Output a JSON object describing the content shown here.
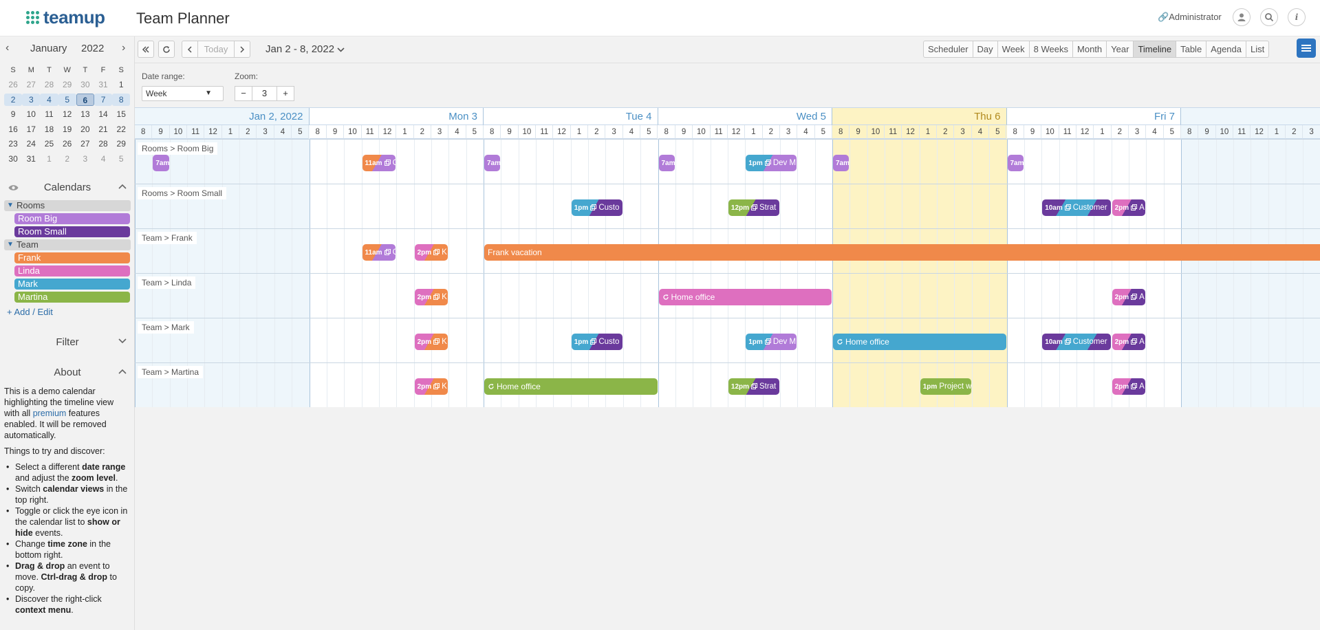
{
  "header": {
    "logo_text": "teamup",
    "title": "Team Planner",
    "admin_label": "Administrator"
  },
  "mini_calendar": {
    "month": "January",
    "year": "2022",
    "dow": [
      "S",
      "M",
      "T",
      "W",
      "T",
      "F",
      "S"
    ],
    "weeks": [
      [
        "26",
        "27",
        "28",
        "29",
        "30",
        "31",
        "1"
      ],
      [
        "2",
        "3",
        "4",
        "5",
        "6",
        "7",
        "8"
      ],
      [
        "9",
        "10",
        "11",
        "12",
        "13",
        "14",
        "15"
      ],
      [
        "16",
        "17",
        "18",
        "19",
        "20",
        "21",
        "22"
      ],
      [
        "23",
        "24",
        "25",
        "26",
        "27",
        "28",
        "29"
      ],
      [
        "30",
        "31",
        "1",
        "2",
        "3",
        "4",
        "5"
      ]
    ]
  },
  "sidebar": {
    "calendars_title": "Calendars",
    "groups": [
      {
        "name": "Rooms",
        "items": [
          {
            "name": "Room Big",
            "color": "#b17bd8"
          },
          {
            "name": "Room Small",
            "color": "#6a3a9c"
          }
        ]
      },
      {
        "name": "Team",
        "items": [
          {
            "name": "Frank",
            "color": "#f0894a"
          },
          {
            "name": "Linda",
            "color": "#de6fbf"
          },
          {
            "name": "Mark",
            "color": "#45a7cf"
          },
          {
            "name": "Martina",
            "color": "#8bb548"
          }
        ]
      }
    ],
    "add_edit": "+ Add / Edit",
    "filter_title": "Filter",
    "about_title": "About",
    "about": {
      "p1_a": "This is a demo calendar highlighting the timeline view with all ",
      "p1_link": "premium",
      "p1_b": " features enabled. It will be removed automatically.",
      "p2": "Things to try and discover:",
      "tips": [
        {
          "a": "Select a different ",
          "b": "date range",
          "c": " and adjust the ",
          "d": "zoom level",
          "e": "."
        },
        {
          "a": "Switch ",
          "b": "calendar views",
          "c": " in the top right.",
          "d": "",
          "e": ""
        },
        {
          "a": "Toggle or click the eye icon in the calendar list to ",
          "b": "show or hide",
          "c": " events.",
          "d": "",
          "e": ""
        },
        {
          "a": "Change ",
          "b": "time zone",
          "c": " in the bottom right.",
          "d": "",
          "e": ""
        },
        {
          "a": "",
          "b": "Drag & drop",
          "c": " an event to move. ",
          "d": "Ctrl-drag & drop",
          "e": " to copy."
        },
        {
          "a": "Discover the right-click ",
          "b": "context menu",
          "c": ".",
          "d": "",
          "e": ""
        }
      ]
    }
  },
  "toolbar": {
    "today_label": "Today",
    "date_range": "Jan 2 - 8, 2022",
    "views": [
      "Scheduler",
      "Day",
      "Week",
      "8 Weeks",
      "Month",
      "Year",
      "Timeline",
      "Table",
      "Agenda",
      "List"
    ],
    "active_view": "Timeline"
  },
  "options": {
    "date_range_label": "Date range:",
    "date_range_value": "Week",
    "zoom_label": "Zoom:",
    "zoom_value": "3",
    "zoom_minus": "−",
    "zoom_plus": "+"
  },
  "timeline": {
    "days": [
      {
        "label": "Jan 2, 2022",
        "today": false
      },
      {
        "label": "Mon 3",
        "today": false
      },
      {
        "label": "Tue 4",
        "today": false
      },
      {
        "label": "Wed 5",
        "today": false
      },
      {
        "label": "Thu 6",
        "today": true
      },
      {
        "label": "Fri 7",
        "today": false
      },
      {
        "label": "",
        "today": false
      }
    ],
    "hours": [
      "8",
      "9",
      "10",
      "11",
      "12",
      "1",
      "2",
      "3",
      "4",
      "5"
    ],
    "rows": [
      "Rooms > Room Big",
      "Rooms > Room Small",
      "Team > Frank",
      "Team > Linda",
      "Team > Mark",
      "Team > Martina"
    ],
    "events": [
      {
        "row": 0,
        "day": 0,
        "start": 9.0,
        "end": 10.0,
        "time": "7am",
        "title": "",
        "colors": [
          "#b17bd8"
        ],
        "icon": ""
      },
      {
        "row": 0,
        "day": 1,
        "start": 11.0,
        "end": 13.0,
        "time": "11am",
        "title": "C",
        "colors": [
          "#f0894a",
          "#b17bd8"
        ],
        "icon": "copy"
      },
      {
        "row": 0,
        "day": 2,
        "start": 8.0,
        "end": 9.0,
        "time": "7am",
        "title": "",
        "colors": [
          "#b17bd8"
        ],
        "icon": ""
      },
      {
        "row": 0,
        "day": 3,
        "start": 8.0,
        "end": 9.0,
        "time": "7am",
        "title": "",
        "colors": [
          "#b17bd8"
        ],
        "icon": ""
      },
      {
        "row": 0,
        "day": 3,
        "start": 13.0,
        "end": 16.0,
        "time": "1pm",
        "title": "Dev M",
        "colors": [
          "#45a7cf",
          "#b17bd8"
        ],
        "icon": "copy"
      },
      {
        "row": 0,
        "day": 4,
        "start": 8.0,
        "end": 9.0,
        "time": "7am",
        "title": "",
        "colors": [
          "#b17bd8"
        ],
        "icon": ""
      },
      {
        "row": 0,
        "day": 5,
        "start": 8.0,
        "end": 9.0,
        "time": "7am",
        "title": "",
        "colors": [
          "#b17bd8"
        ],
        "icon": ""
      },
      {
        "row": 1,
        "day": 2,
        "start": 13.0,
        "end": 16.0,
        "time": "1pm",
        "title": "Custo",
        "colors": [
          "#45a7cf",
          "#6a3a9c"
        ],
        "icon": "copy"
      },
      {
        "row": 1,
        "day": 3,
        "start": 12.0,
        "end": 15.0,
        "time": "12pm",
        "title": "Strat",
        "colors": [
          "#8bb548",
          "#6a3a9c"
        ],
        "icon": "copy"
      },
      {
        "row": 1,
        "day": 5,
        "start": 10.0,
        "end": 14.0,
        "time": "10am",
        "title": "Customer",
        "colors": [
          "#6a3a9c",
          "#45a7cf",
          "#6a3a9c"
        ],
        "icon": "copy"
      },
      {
        "row": 1,
        "day": 5,
        "start": 14.0,
        "end": 16.0,
        "time": "2pm",
        "title": "A",
        "colors": [
          "#de6fbf",
          "#6a3a9c"
        ],
        "icon": "copy"
      },
      {
        "row": 2,
        "day": 1,
        "start": 11.0,
        "end": 13.0,
        "time": "11am",
        "title": "C",
        "colors": [
          "#f0894a",
          "#b17bd8"
        ],
        "icon": "copy"
      },
      {
        "row": 2,
        "day": 1,
        "start": 14.0,
        "end": 16.0,
        "time": "2pm",
        "title": "K",
        "colors": [
          "#de6fbf",
          "#f0894a"
        ],
        "icon": "copy"
      },
      {
        "row": 2,
        "day": 2,
        "start": 8.0,
        "end": 99.0,
        "time": "",
        "title": "Frank vacation",
        "colors": [
          "#f0894a"
        ],
        "icon": "",
        "long": true
      },
      {
        "row": 3,
        "day": 1,
        "start": 14.0,
        "end": 16.0,
        "time": "2pm",
        "title": "K",
        "colors": [
          "#de6fbf",
          "#f0894a"
        ],
        "icon": "copy"
      },
      {
        "row": 3,
        "day": 3,
        "start": 8.0,
        "end": 18.0,
        "time": "",
        "title": "Home office",
        "colors": [
          "#de6fbf"
        ],
        "icon": "repeat",
        "long": true
      },
      {
        "row": 3,
        "day": 5,
        "start": 14.0,
        "end": 16.0,
        "time": "2pm",
        "title": "A",
        "colors": [
          "#de6fbf",
          "#6a3a9c"
        ],
        "icon": "copy"
      },
      {
        "row": 4,
        "day": 1,
        "start": 14.0,
        "end": 16.0,
        "time": "2pm",
        "title": "K",
        "colors": [
          "#de6fbf",
          "#f0894a"
        ],
        "icon": "copy"
      },
      {
        "row": 4,
        "day": 2,
        "start": 13.0,
        "end": 16.0,
        "time": "1pm",
        "title": "Custo",
        "colors": [
          "#45a7cf",
          "#6a3a9c"
        ],
        "icon": "copy"
      },
      {
        "row": 4,
        "day": 3,
        "start": 13.0,
        "end": 16.0,
        "time": "1pm",
        "title": "Dev M",
        "colors": [
          "#45a7cf",
          "#b17bd8"
        ],
        "icon": "copy"
      },
      {
        "row": 4,
        "day": 4,
        "start": 8.0,
        "end": 18.0,
        "time": "",
        "title": "Home office",
        "colors": [
          "#45a7cf"
        ],
        "icon": "repeat",
        "long": true
      },
      {
        "row": 4,
        "day": 5,
        "start": 10.0,
        "end": 14.0,
        "time": "10am",
        "title": "Customer",
        "colors": [
          "#6a3a9c",
          "#45a7cf",
          "#6a3a9c"
        ],
        "icon": "copy"
      },
      {
        "row": 4,
        "day": 5,
        "start": 14.0,
        "end": 16.0,
        "time": "2pm",
        "title": "A",
        "colors": [
          "#de6fbf",
          "#6a3a9c"
        ],
        "icon": "copy"
      },
      {
        "row": 5,
        "day": 1,
        "start": 14.0,
        "end": 16.0,
        "time": "2pm",
        "title": "K",
        "colors": [
          "#de6fbf",
          "#f0894a"
        ],
        "icon": "copy"
      },
      {
        "row": 5,
        "day": 2,
        "start": 8.0,
        "end": 18.0,
        "time": "",
        "title": "Home office",
        "colors": [
          "#8bb548"
        ],
        "icon": "repeat",
        "long": true
      },
      {
        "row": 5,
        "day": 3,
        "start": 12.0,
        "end": 15.0,
        "time": "12pm",
        "title": "Strat",
        "colors": [
          "#8bb548",
          "#6a3a9c"
        ],
        "icon": "copy"
      },
      {
        "row": 5,
        "day": 4,
        "start": 13.0,
        "end": 16.0,
        "time": "1pm",
        "title": "Project w",
        "colors": [
          "#8bb548"
        ],
        "icon": ""
      },
      {
        "row": 5,
        "day": 5,
        "start": 14.0,
        "end": 16.0,
        "time": "2pm",
        "title": "A",
        "colors": [
          "#de6fbf",
          "#6a3a9c"
        ],
        "icon": "copy"
      }
    ]
  }
}
